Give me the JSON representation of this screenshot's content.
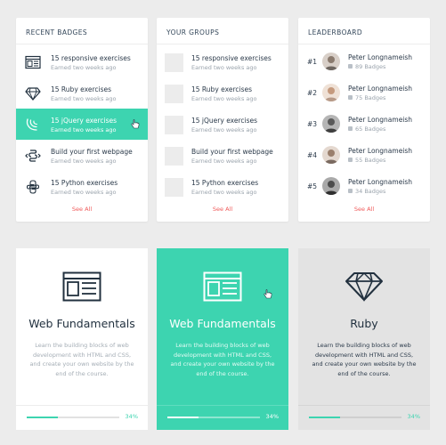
{
  "colors": {
    "accent": "#3dd4b0",
    "link": "#ef5a5a",
    "text_dark": "#2b3a4a",
    "text_muted": "#9aa3ac",
    "background": "#ececec"
  },
  "recent_badges": {
    "title": "RECENT BADGES",
    "items": [
      {
        "icon": "browser-window-icon",
        "title": "15 responsive exercises",
        "subtitle": "Earned two weeks ago"
      },
      {
        "icon": "diamond-icon",
        "title": "15 Ruby exercises",
        "subtitle": "Earned two weeks ago"
      },
      {
        "icon": "jquery-icon",
        "title": "15 jQuery exercises",
        "subtitle": "Earned two weeks ago"
      },
      {
        "icon": "html-brackets-icon",
        "title": "Build your first webpage",
        "subtitle": "Earned two weeks ago"
      },
      {
        "icon": "python-icon",
        "title": "15 Python exercises",
        "subtitle": "Earned two weeks ago"
      }
    ],
    "see_all": "See All"
  },
  "your_groups": {
    "title": "YOUR GROUPS",
    "items": [
      {
        "title": "15 responsive exercises",
        "subtitle": "Earned two weeks ago"
      },
      {
        "title": "15 Ruby exercises",
        "subtitle": "Earned two weeks ago"
      },
      {
        "title": "15 jQuery exercises",
        "subtitle": "Earned two weeks ago"
      },
      {
        "title": "Build your first webpage",
        "subtitle": "Earned two weeks ago"
      },
      {
        "title": "15 Python exercises",
        "subtitle": "Earned two weeks ago"
      }
    ],
    "see_all": "See All"
  },
  "leaderboard": {
    "title": "LEADERBOARD",
    "items": [
      {
        "rank": "#1",
        "name": "Peter Longnameish",
        "badges": "89 Badges"
      },
      {
        "rank": "#2",
        "name": "Peter Longnameish",
        "badges": "75 Badges"
      },
      {
        "rank": "#3",
        "name": "Peter Longnameish",
        "badges": "65 Badges"
      },
      {
        "rank": "#4",
        "name": "Peter Longnameish",
        "badges": "55 Badges"
      },
      {
        "rank": "#5",
        "name": "Peter Longnameish",
        "badges": "34 Badges"
      }
    ],
    "see_all": "See All"
  },
  "courses": [
    {
      "icon": "browser-window-icon",
      "title": "Web Fundamentals",
      "description": "Learn the building blocks of web development with HTML and CSS, and create your own website by the end of the course.",
      "progress": 0.34,
      "progress_label": "34%"
    },
    {
      "icon": "browser-window-icon",
      "title": "Web Fundamentals",
      "description": "Learn the building blocks of web development with HTML and CSS, and create your own website by the end of the course.",
      "progress": 0.34,
      "progress_label": "34%"
    },
    {
      "icon": "diamond-icon",
      "title": "Ruby",
      "description": "Learn the building blocks of web development with HTML and CSS, and create your own website by the end of the course.",
      "progress": 0.34,
      "progress_label": "34%"
    }
  ]
}
